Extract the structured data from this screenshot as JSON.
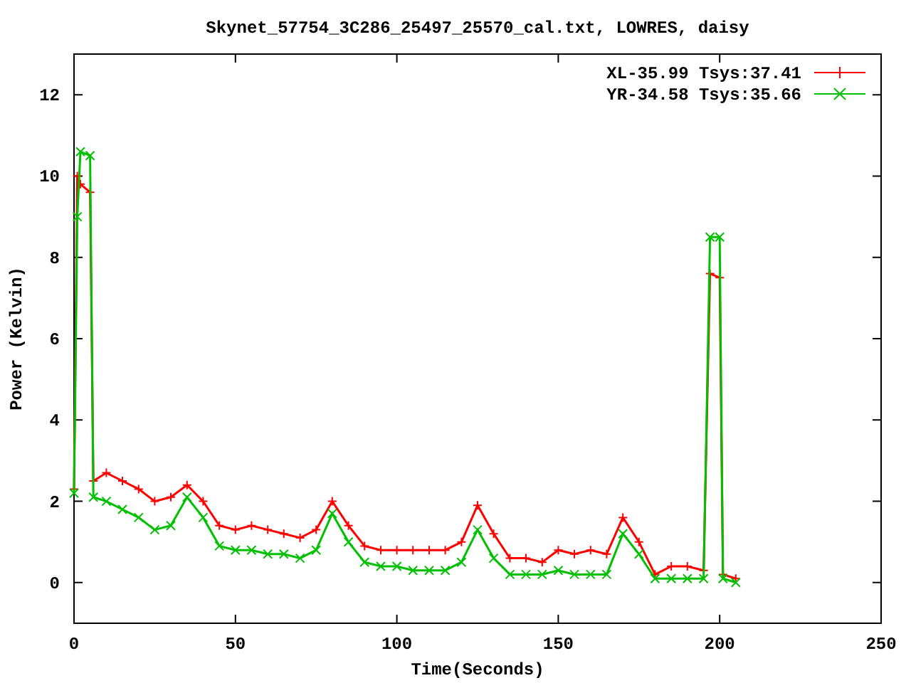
{
  "chart_data": {
    "type": "line",
    "title": "Skynet_57754_3C286_25497_25570_cal.txt, LOWRES, daisy",
    "xlabel": "Time(Seconds)",
    "ylabel": "Power (Kelvin)",
    "x": [
      0,
      1,
      2,
      5,
      6,
      10,
      15,
      20,
      25,
      30,
      35,
      40,
      45,
      50,
      55,
      60,
      65,
      70,
      75,
      80,
      85,
      90,
      95,
      100,
      105,
      110,
      115,
      120,
      125,
      130,
      135,
      140,
      145,
      150,
      155,
      160,
      165,
      170,
      175,
      180,
      185,
      190,
      195,
      197,
      200,
      201,
      205
    ],
    "series": [
      {
        "name": "XL-35.99 Tsys:37.41",
        "color": "#ff0000",
        "values": [
          2.3,
          10.0,
          9.8,
          9.6,
          2.5,
          2.7,
          2.5,
          2.3,
          2.0,
          2.1,
          2.4,
          2.0,
          1.4,
          1.3,
          1.4,
          1.3,
          1.2,
          1.1,
          1.3,
          2.0,
          1.4,
          0.9,
          0.8,
          0.8,
          0.8,
          0.8,
          0.8,
          1.0,
          1.9,
          1.2,
          0.6,
          0.6,
          0.5,
          0.8,
          0.7,
          0.8,
          0.7,
          1.6,
          1.0,
          0.2,
          0.4,
          0.4,
          0.3,
          7.6,
          7.5,
          0.2,
          0.1
        ]
      },
      {
        "name": "YR-34.58 Tsys:35.66",
        "color": "#00c000",
        "values": [
          2.2,
          9.0,
          10.6,
          10.5,
          2.1,
          2.0,
          1.8,
          1.6,
          1.3,
          1.4,
          2.1,
          1.6,
          0.9,
          0.8,
          0.8,
          0.7,
          0.7,
          0.6,
          0.8,
          1.7,
          1.0,
          0.5,
          0.4,
          0.4,
          0.3,
          0.3,
          0.3,
          0.5,
          1.3,
          0.6,
          0.2,
          0.2,
          0.2,
          0.3,
          0.2,
          0.2,
          0.2,
          1.2,
          0.7,
          0.1,
          0.1,
          0.1,
          0.1,
          8.5,
          8.5,
          0.1,
          0.0
        ]
      }
    ],
    "xlim": [
      0,
      250
    ],
    "ylim": [
      -1,
      13
    ],
    "xticks": [
      0,
      50,
      100,
      150,
      200,
      250
    ],
    "yticks": [
      0,
      2,
      4,
      6,
      8,
      10,
      12
    ],
    "legend": true
  }
}
